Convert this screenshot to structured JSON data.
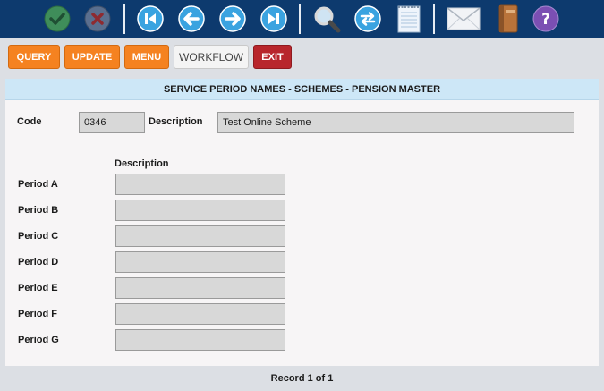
{
  "toolbar": {
    "icons": [
      "confirm-icon",
      "cancel-icon",
      "first-record-icon",
      "previous-record-icon",
      "next-record-icon",
      "last-record-icon",
      "search-icon",
      "refresh-icon",
      "notepad-icon",
      "mail-icon",
      "book-icon",
      "help-icon"
    ],
    "colors": {
      "background": "#0d3a6e",
      "confirm": "#3f8d5a",
      "cancel": "#5a6f8f",
      "nav": "#3aa3e0",
      "help": "#7b4fb3"
    }
  },
  "actions": {
    "query_label": "QUERY",
    "update_label": "UPDATE",
    "menu_label": "MENU",
    "workflow_label": "WORKFLOW",
    "exit_label": "EXIT",
    "colors": {
      "orange": "#f58220",
      "red": "#b8262c"
    }
  },
  "form": {
    "title": "SERVICE PERIOD NAMES - SCHEMES - PENSION MASTER",
    "code_label": "Code",
    "code_value": "0346",
    "description_label": "Description",
    "description_value": "Test Online Scheme",
    "column_header": "Description",
    "periods": [
      {
        "label": "Period A",
        "value": ""
      },
      {
        "label": "Period B",
        "value": ""
      },
      {
        "label": "Period C",
        "value": ""
      },
      {
        "label": "Period D",
        "value": ""
      },
      {
        "label": "Period E",
        "value": ""
      },
      {
        "label": "Period F",
        "value": ""
      },
      {
        "label": "Period G",
        "value": ""
      }
    ]
  },
  "status": {
    "record_text": "Record 1 of 1"
  }
}
